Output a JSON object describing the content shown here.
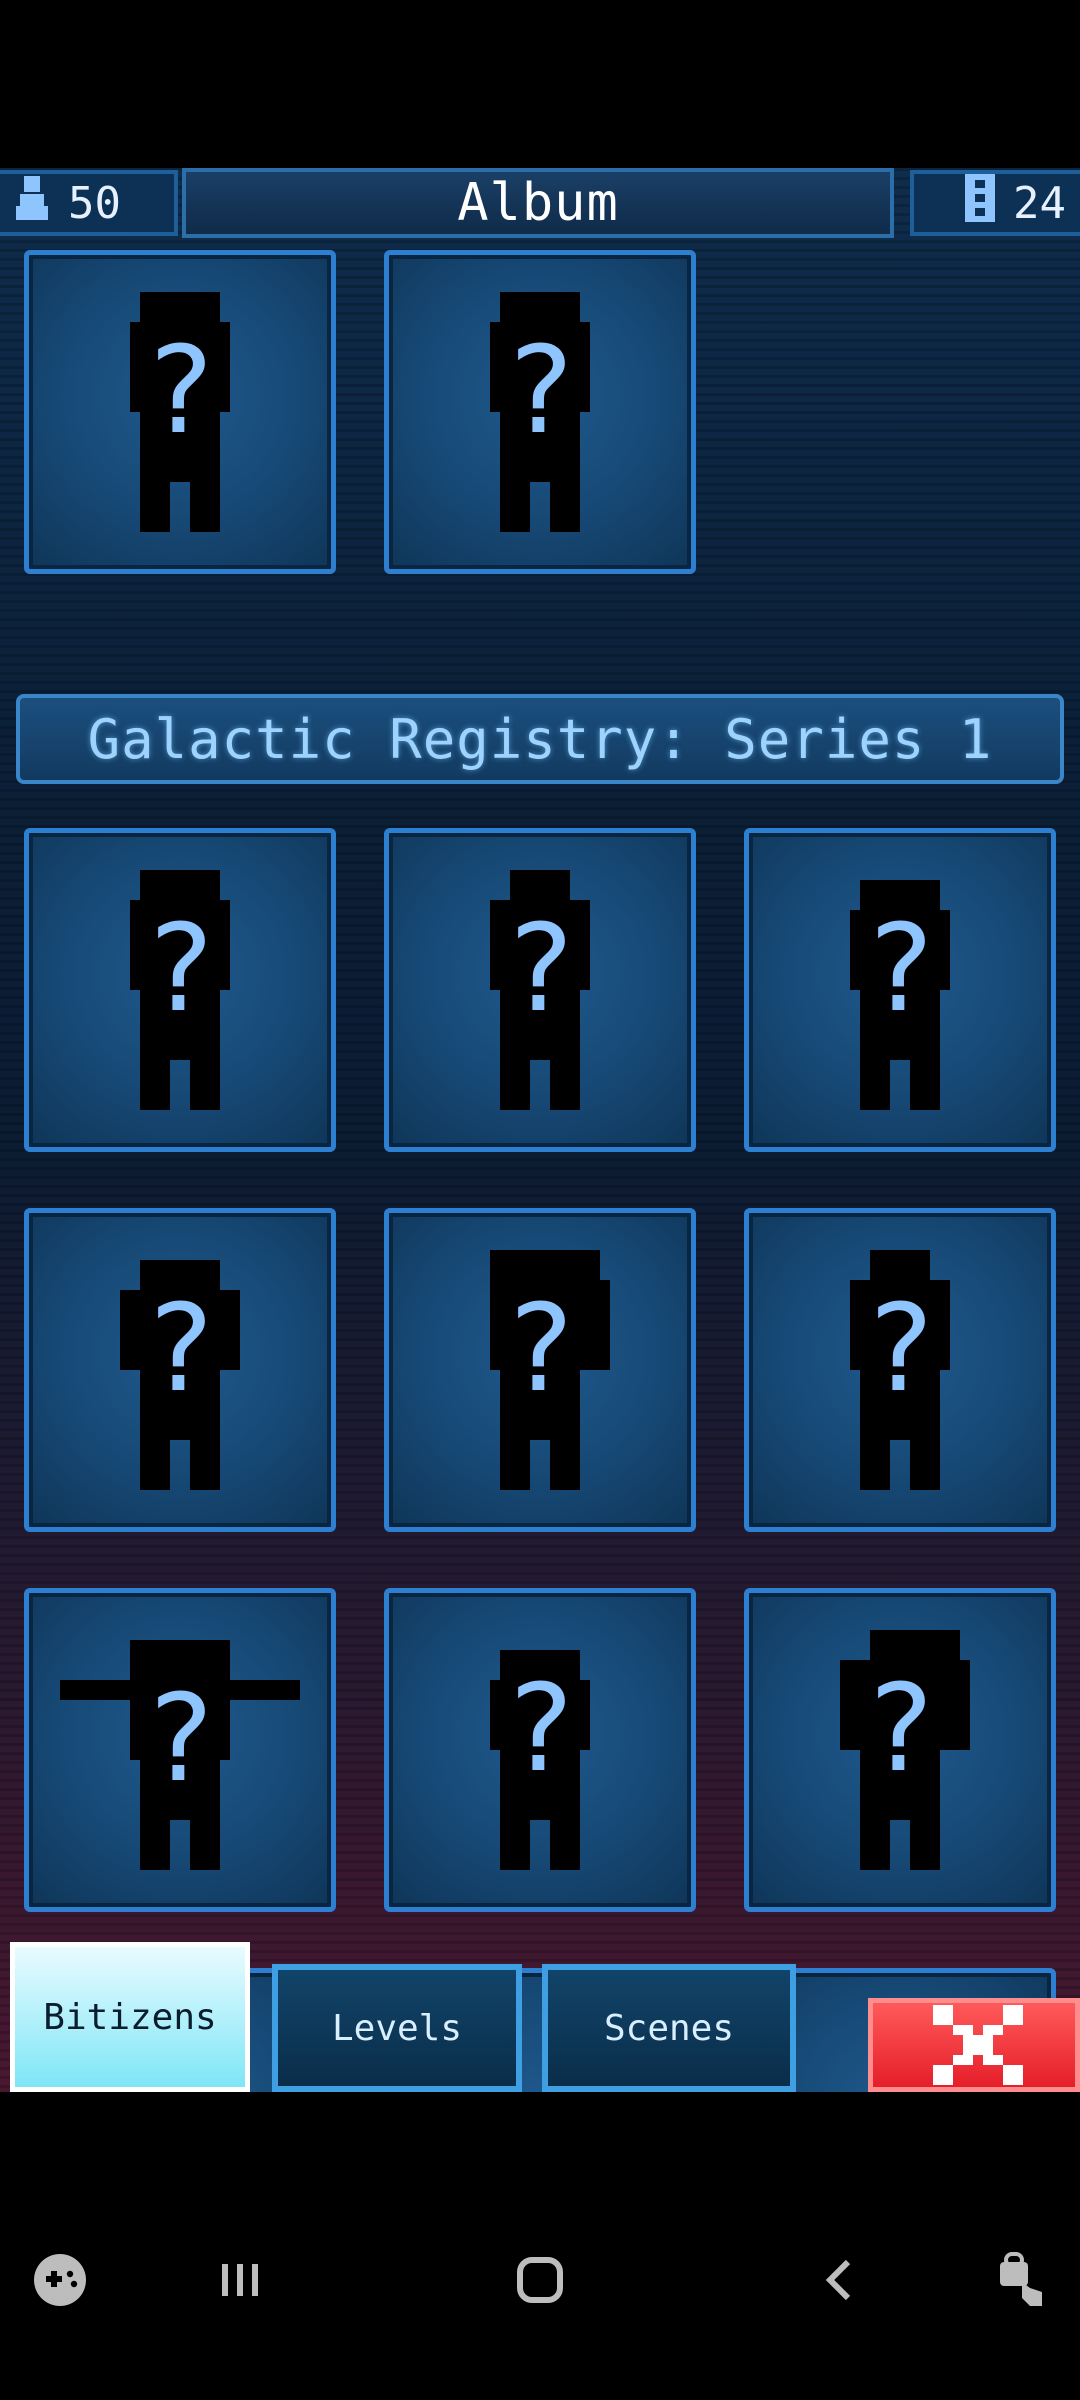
{
  "header": {
    "title": "Album",
    "bitizens_count": "50",
    "scenes_count": "24"
  },
  "banner": {
    "text": "Galactic Registry: Series 1"
  },
  "card_placeholder": "?",
  "tabs": {
    "bitizens": "Bitizens",
    "levels": "Levels",
    "scenes": "Scenes"
  },
  "colors": {
    "accent": "#2d7fd1",
    "question": "#8fc5ff",
    "close": "#e51e2a"
  },
  "icons": {
    "bitizens_count": "person-icon",
    "scenes_count": "film-icon",
    "close": "close-icon"
  }
}
